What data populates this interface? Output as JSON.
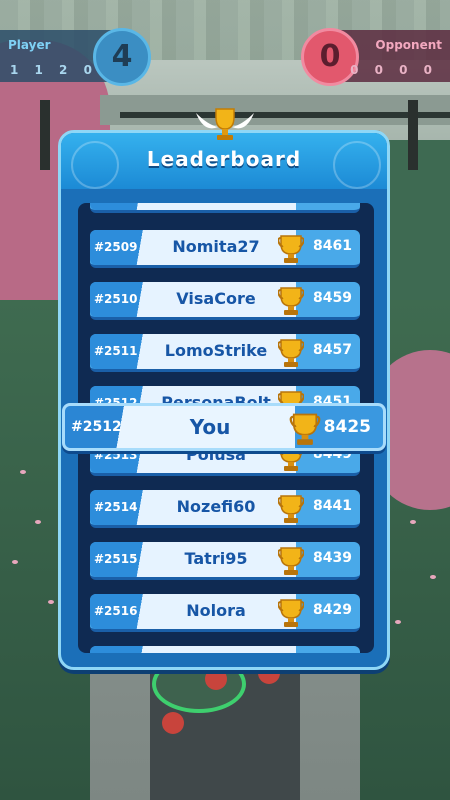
{
  "hud": {
    "player": {
      "label": "Player",
      "digits": "1 1 2 0",
      "count": "4"
    },
    "opponent": {
      "label": "Opponent",
      "digits": "0 0 0 0",
      "count": "0"
    }
  },
  "leaderboard": {
    "title": "Leaderboard",
    "rows": [
      {
        "rank": "#2509",
        "name": "Nomita27",
        "score": "8461"
      },
      {
        "rank": "#2510",
        "name": "VisaCore",
        "score": "8459"
      },
      {
        "rank": "#2511",
        "name": "LomoStrike",
        "score": "8457"
      },
      {
        "rank": "#2512",
        "name": "PersonaBolt",
        "score": "8451"
      },
      {
        "rank": "#2513",
        "name": "Polusa",
        "score": "8449"
      },
      {
        "rank": "#2514",
        "name": "Nozefi60",
        "score": "8441"
      },
      {
        "rank": "#2515",
        "name": "Tatri95",
        "score": "8439"
      },
      {
        "rank": "#2516",
        "name": "Nolora",
        "score": "8429"
      }
    ],
    "you": {
      "rank": "#2512",
      "name": "You",
      "score": "8425"
    }
  },
  "colors": {
    "panel": "#1b6fb8",
    "header": "#35b1ee",
    "row": "#49a9e9",
    "name_text": "#1756a6",
    "trophy": "#f2b418"
  },
  "icons": {
    "trophy": "trophy-icon",
    "winged_trophy": "winged-trophy-icon"
  }
}
